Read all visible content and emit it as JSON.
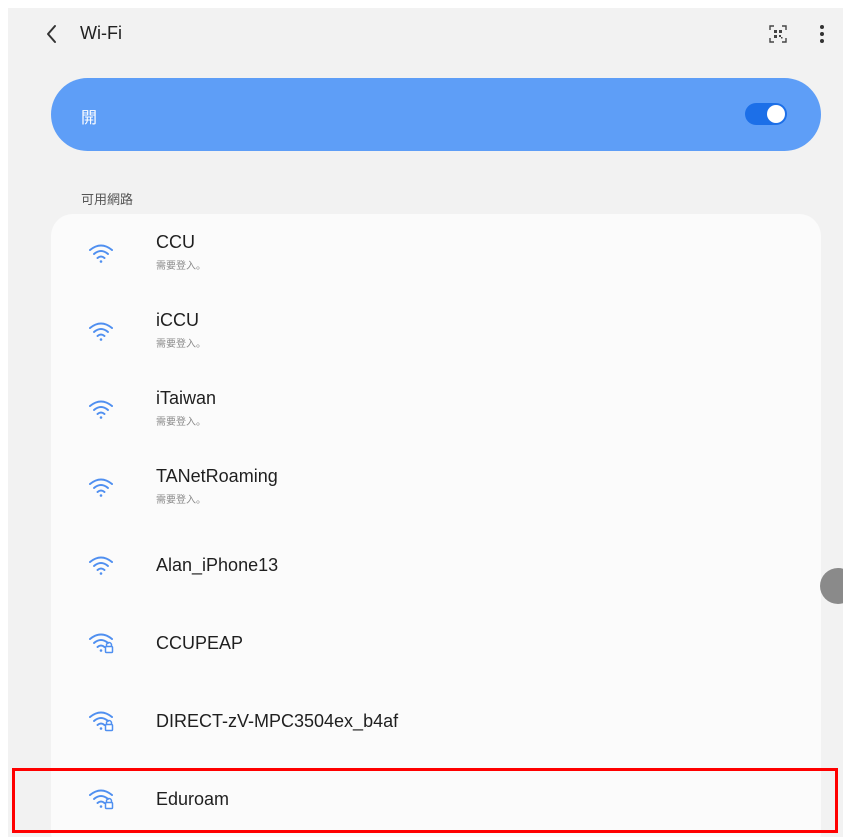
{
  "header": {
    "title": "Wi-Fi",
    "back_icon": "chevron-left-icon",
    "qr_icon": "qr-code-icon",
    "more_icon": "more-vertical-icon"
  },
  "master_toggle": {
    "label": "開",
    "state": "on",
    "bar_color": "#5e9ef7",
    "toggle_color": "#1c6fe8"
  },
  "available_networks": {
    "section_label": "可用網路",
    "items": [
      {
        "name": "CCU",
        "status": "需要登入。",
        "secured": false,
        "icon": "wifi-icon"
      },
      {
        "name": "iCCU",
        "status": "需要登入。",
        "secured": false,
        "icon": "wifi-icon"
      },
      {
        "name": "iTaiwan",
        "status": "需要登入。",
        "secured": false,
        "icon": "wifi-icon"
      },
      {
        "name": "TANetRoaming",
        "status": "需要登入。",
        "secured": false,
        "icon": "wifi-icon"
      },
      {
        "name": "Alan_iPhone13",
        "status": "",
        "secured": false,
        "icon": "wifi-icon"
      },
      {
        "name": "CCUPEAP",
        "status": "",
        "secured": true,
        "icon": "wifi-lock-icon"
      },
      {
        "name": "DIRECT-zV-MPC3504ex_b4af",
        "status": "",
        "secured": true,
        "icon": "wifi-lock-icon"
      },
      {
        "name": "Eduroam",
        "status": "",
        "secured": true,
        "icon": "wifi-lock-icon"
      }
    ]
  },
  "colors": {
    "accent": "#5e9ef7",
    "wifi_icon": "#4f8ff0",
    "highlight": "#ff0000",
    "background": "#f2f2f2"
  }
}
